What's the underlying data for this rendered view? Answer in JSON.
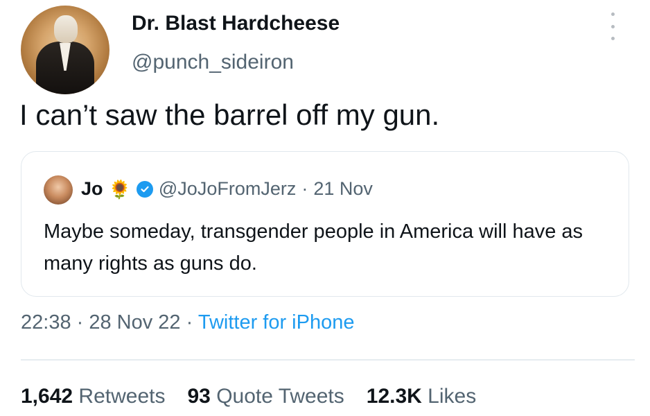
{
  "tweet": {
    "author": {
      "display_name": "Dr. Blast Hardcheese",
      "handle": "@punch_sideiron"
    },
    "text": "I can’t saw the barrel off my gun.",
    "quoted": {
      "display_name": "Jo",
      "emoji_icon": "sunflower-icon",
      "verified": true,
      "handle": "@JoJoFromJerz",
      "separator": "·",
      "date": "21 Nov",
      "text": "Maybe someday, transgender people in America will have as many rights as guns do."
    },
    "time": "22:38",
    "date": "28 Nov 22",
    "source": "Twitter for iPhone",
    "stats": {
      "retweets_count": "1,642",
      "retweets_label": "Retweets",
      "quote_tweets_count": "93",
      "quote_tweets_label": "Quote Tweets",
      "likes_count": "12.3K",
      "likes_label": "Likes"
    }
  },
  "colors": {
    "text": "#0f1419",
    "secondary": "#536471",
    "accent": "#1d9bf0",
    "border": "#e1e8ed"
  }
}
